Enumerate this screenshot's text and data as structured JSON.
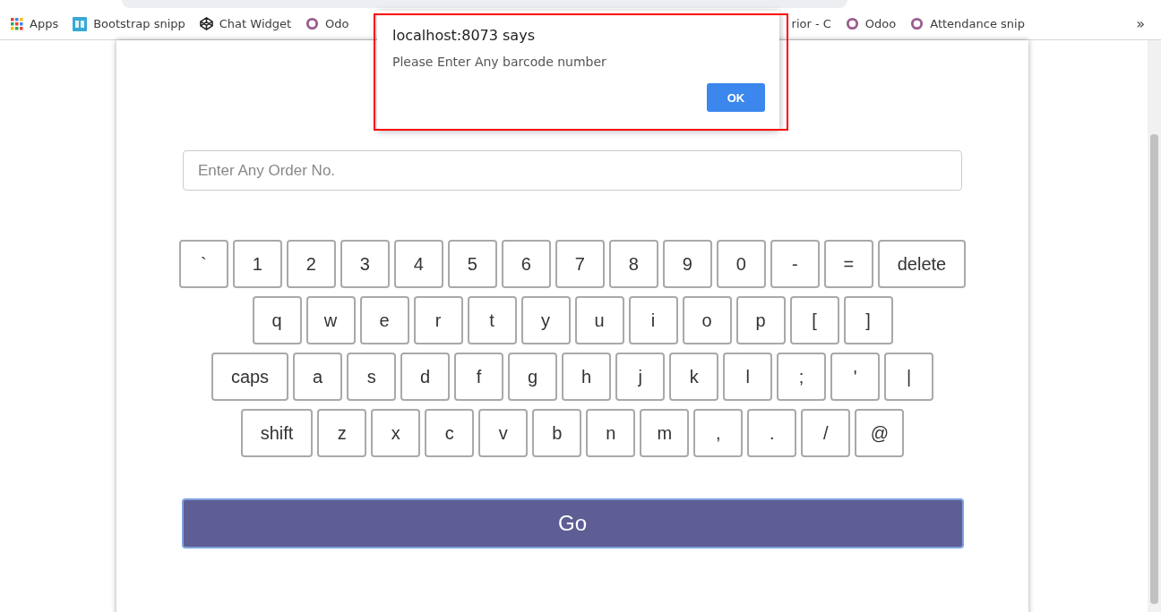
{
  "bookmarks": [
    {
      "kind": "apps",
      "label": "Apps"
    },
    {
      "kind": "bd",
      "label": "Bootstrap snipp"
    },
    {
      "kind": "cube",
      "label": "Chat Widget"
    },
    {
      "kind": "ring",
      "label": "Odo"
    },
    {
      "kind": "plain",
      "label": "rior - C"
    },
    {
      "kind": "ring",
      "label": "Odoo"
    },
    {
      "kind": "ring",
      "label": "Attendance snip"
    }
  ],
  "bookmarks_more": "»",
  "order_field": {
    "placeholder": "Enter Any Order No."
  },
  "keyboard": [
    [
      {
        "label": "`",
        "kind": "key"
      },
      {
        "label": "1",
        "kind": "key"
      },
      {
        "label": "2",
        "kind": "key"
      },
      {
        "label": "3",
        "kind": "key"
      },
      {
        "label": "4",
        "kind": "key"
      },
      {
        "label": "5",
        "kind": "key"
      },
      {
        "label": "6",
        "kind": "key"
      },
      {
        "label": "7",
        "kind": "key"
      },
      {
        "label": "8",
        "kind": "key"
      },
      {
        "label": "9",
        "kind": "key"
      },
      {
        "label": "0",
        "kind": "key"
      },
      {
        "label": "-",
        "kind": "key"
      },
      {
        "label": "=",
        "kind": "key"
      },
      {
        "label": "delete",
        "kind": "wide"
      }
    ],
    [
      {
        "label": "q",
        "kind": "key"
      },
      {
        "label": "w",
        "kind": "key"
      },
      {
        "label": "e",
        "kind": "key"
      },
      {
        "label": "r",
        "kind": "key"
      },
      {
        "label": "t",
        "kind": "key"
      },
      {
        "label": "y",
        "kind": "key"
      },
      {
        "label": "u",
        "kind": "key"
      },
      {
        "label": "i",
        "kind": "key"
      },
      {
        "label": "o",
        "kind": "key"
      },
      {
        "label": "p",
        "kind": "key"
      },
      {
        "label": "[",
        "kind": "key"
      },
      {
        "label": "]",
        "kind": "key"
      }
    ],
    [
      {
        "label": "caps",
        "kind": "wide"
      },
      {
        "label": "a",
        "kind": "key"
      },
      {
        "label": "s",
        "kind": "key"
      },
      {
        "label": "d",
        "kind": "key"
      },
      {
        "label": "f",
        "kind": "key"
      },
      {
        "label": "g",
        "kind": "key"
      },
      {
        "label": "h",
        "kind": "key"
      },
      {
        "label": "j",
        "kind": "key"
      },
      {
        "label": "k",
        "kind": "key"
      },
      {
        "label": "l",
        "kind": "key"
      },
      {
        "label": ";",
        "kind": "key"
      },
      {
        "label": "'",
        "kind": "key"
      },
      {
        "label": "|",
        "kind": "key"
      }
    ],
    [
      {
        "label": "shift",
        "kind": "wide"
      },
      {
        "label": "z",
        "kind": "key"
      },
      {
        "label": "x",
        "kind": "key"
      },
      {
        "label": "c",
        "kind": "key"
      },
      {
        "label": "v",
        "kind": "key"
      },
      {
        "label": "b",
        "kind": "key"
      },
      {
        "label": "n",
        "kind": "key"
      },
      {
        "label": "m",
        "kind": "key"
      },
      {
        "label": ",",
        "kind": "key"
      },
      {
        "label": ".",
        "kind": "key"
      },
      {
        "label": "/",
        "kind": "key"
      },
      {
        "label": "@",
        "kind": "key"
      }
    ]
  ],
  "go_button": "Go",
  "dialog": {
    "title": "localhost:8073 says",
    "message": "Please Enter Any barcode number",
    "button": "OK",
    "highlighted": true
  }
}
